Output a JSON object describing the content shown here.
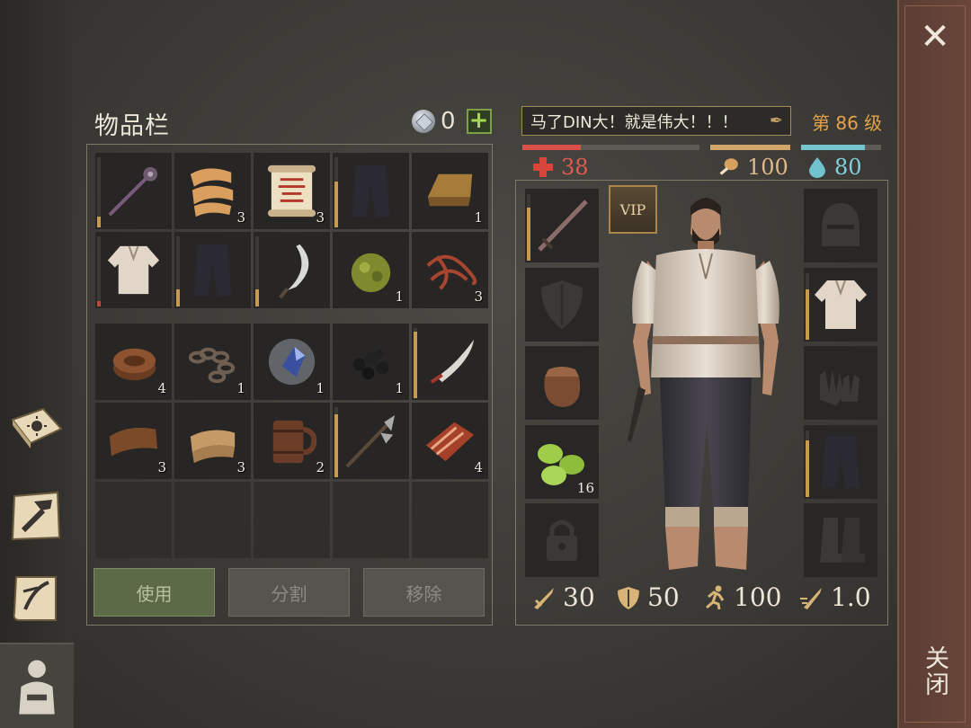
{
  "inventory": {
    "title": "物品栏",
    "gem_count": "0",
    "rows_top": [
      {
        "icon": "mace-icon",
        "qty": "",
        "durability": 0.15,
        "dur_color": "#c89a4c"
      },
      {
        "icon": "cloth-roll-icon",
        "qty": "3"
      },
      {
        "icon": "scroll-icon",
        "qty": "3"
      },
      {
        "icon": "trousers-icon",
        "qty": "",
        "durability": 0.65,
        "dur_color": "#c89a4c"
      },
      {
        "icon": "ingot-icon",
        "qty": "1"
      },
      {
        "icon": "shirt-icon",
        "qty": "",
        "durability": 0.08,
        "dur_color": "#c0463f"
      },
      {
        "icon": "trousers-icon",
        "qty": "",
        "durability": 0.25,
        "dur_color": "#c89a4c"
      },
      {
        "icon": "sickle-icon",
        "qty": "",
        "durability": 0.25,
        "dur_color": "#c89a4c"
      },
      {
        "icon": "herb-ball-icon",
        "qty": "1"
      },
      {
        "icon": "rope-fibers-icon",
        "qty": "3"
      }
    ],
    "rows_bottom": [
      {
        "icon": "leather-roll-icon",
        "qty": "4"
      },
      {
        "icon": "chain-icon",
        "qty": "1"
      },
      {
        "icon": "crystal-icon",
        "qty": "1"
      },
      {
        "icon": "coal-icon",
        "qty": "1"
      },
      {
        "icon": "scimitar-icon",
        "qty": "",
        "durability": 0.95,
        "dur_color": "#c89a4c"
      },
      {
        "icon": "leather-scrap-icon",
        "qty": "3"
      },
      {
        "icon": "cloth-fold-icon",
        "qty": "3"
      },
      {
        "icon": "mug-icon",
        "qty": "2"
      },
      {
        "icon": "halberd-icon",
        "qty": "",
        "durability": 0.9,
        "dur_color": "#c89a4c"
      },
      {
        "icon": "meat-icon",
        "qty": "4"
      }
    ],
    "buttons": {
      "use": "使用",
      "split": "分割",
      "remove": "移除"
    }
  },
  "character": {
    "name": "马了DIN大！就是伟大！！！",
    "level": "第 86 级",
    "health": {
      "value": "38",
      "fill": 0.33,
      "color": "#d9524a"
    },
    "hunger": {
      "value": "100",
      "fill": 1.0,
      "color": "#d4a56a"
    },
    "water": {
      "value": "80",
      "fill": 0.8,
      "color": "#74c3cf"
    },
    "vip": "VIP",
    "left_slots": [
      {
        "icon": "sword-icon",
        "durability": 0.8
      },
      {
        "icon": "shield-icon"
      },
      {
        "icon": "pouch-icon"
      },
      {
        "icon": "cucumber-slices-icon",
        "qty": "16"
      },
      {
        "icon": "lock-icon"
      }
    ],
    "right_slots": [
      {
        "icon": "helmet-icon"
      },
      {
        "icon": "shirt-icon",
        "durability": 0.75
      },
      {
        "icon": "gloves-icon"
      },
      {
        "icon": "trousers-icon",
        "durability": 0.85
      },
      {
        "icon": "boots-icon"
      }
    ],
    "stats": {
      "attack": "30",
      "defense": "50",
      "speed": "100",
      "attack_speed": "1.0"
    }
  },
  "close": {
    "label": "关闭",
    "x": "✕"
  },
  "nav": [
    "journal-icon",
    "craft-icon",
    "quest-scroll-icon",
    "character-icon"
  ]
}
